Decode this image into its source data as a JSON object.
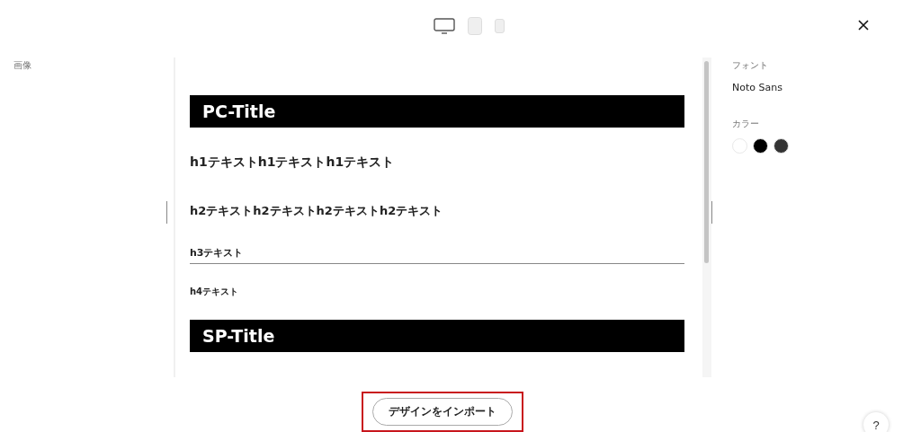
{
  "devices": [
    {
      "kind": "desktop",
      "selected": true
    },
    {
      "kind": "tablet",
      "selected": false
    },
    {
      "kind": "phone",
      "selected": false
    }
  ],
  "left_panel": {
    "label": "画像"
  },
  "preview": {
    "blocks": [
      {
        "kind": "title",
        "text": "PC-Title"
      },
      {
        "kind": "h1",
        "text": "h1テキストh1テキストh1テキスト"
      },
      {
        "kind": "h2",
        "text": "h2テキストh2テキストh2テキストh2テキスト"
      },
      {
        "kind": "h3",
        "text": "h3テキスト"
      },
      {
        "kind": "h4",
        "text": "h4テキスト"
      },
      {
        "kind": "title",
        "text": "SP-Title"
      }
    ]
  },
  "right_panel": {
    "font_label": "フォント",
    "font_value": "Noto Sans",
    "color_label": "カラー",
    "colors": [
      {
        "color": "#ffffff"
      },
      {
        "color": "#000000"
      },
      {
        "color": "#333333"
      }
    ]
  },
  "import_button": "デザインをインポート",
  "help_button": "?"
}
